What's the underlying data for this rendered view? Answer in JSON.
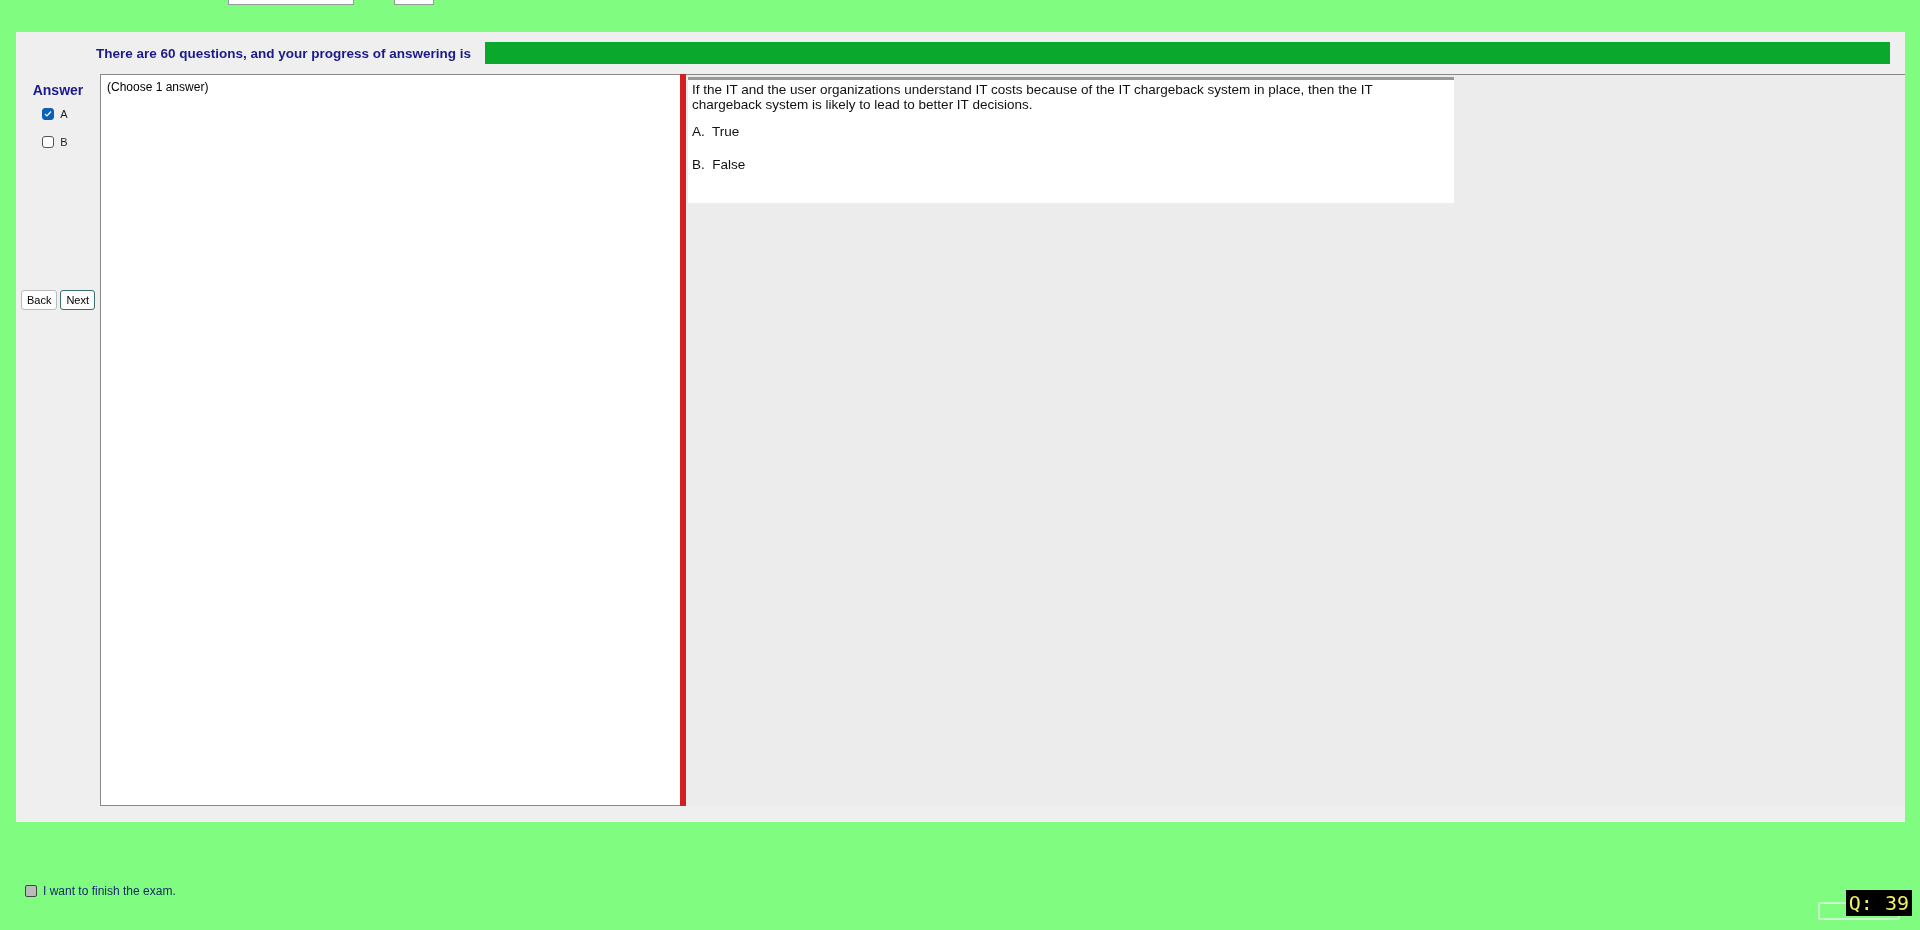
{
  "progress": {
    "label": "There are 60 questions, and your progress of answering is",
    "level": 1
  },
  "answer": {
    "title": "Answer",
    "options": [
      {
        "label": "A",
        "checked": true
      },
      {
        "label": "B",
        "checked": false
      }
    ]
  },
  "navigation": {
    "buttons": [
      "Back",
      "Next"
    ]
  },
  "answer_hint": "(Choose 1 answer)",
  "question": {
    "text": "If the IT and the user organizations understand IT costs because of the IT chargeback system in place, then the IT chargeback system is likely to lead to better IT decisions.",
    "choices": [
      "A.  True",
      "B.  False"
    ]
  },
  "finish": {
    "label": "I want to finish the exam.",
    "checked": false
  },
  "question_counter": "Q: 39"
}
